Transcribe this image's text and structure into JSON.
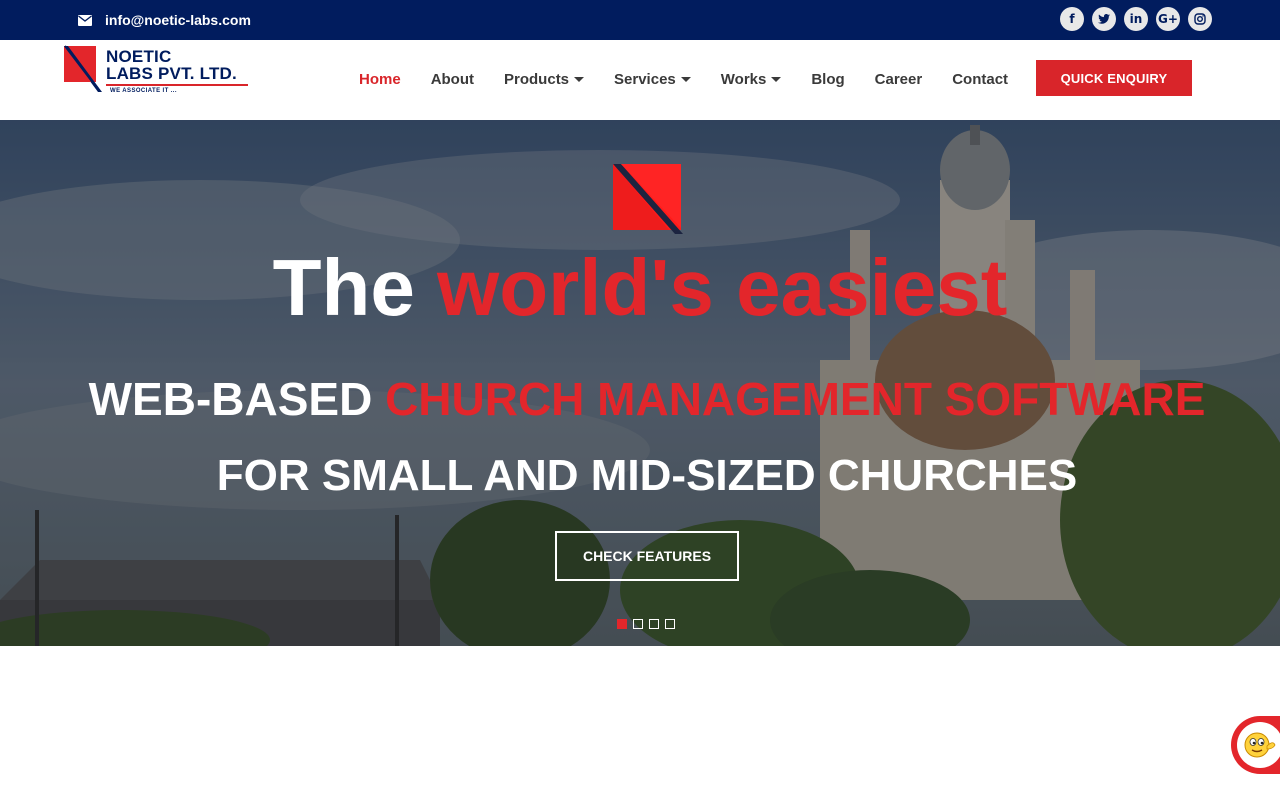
{
  "topbar": {
    "email": "info@noetic-labs.com",
    "mail_icon": "envelope-icon",
    "socials": [
      {
        "name": "facebook-icon",
        "glyph": "f"
      },
      {
        "name": "twitter-icon",
        "glyph": "t"
      },
      {
        "name": "linkedin-icon",
        "glyph": "in"
      },
      {
        "name": "google-plus-icon",
        "glyph": "G+"
      },
      {
        "name": "instagram-icon",
        "glyph": "◎"
      }
    ]
  },
  "logo": {
    "line1": "NOETIC",
    "line2": "LABS PVT. LTD.",
    "tagline": "WE ASSOCIATE IT ..."
  },
  "nav": {
    "home": "Home",
    "about": "About",
    "products": "Products",
    "services": "Services",
    "works": "Works",
    "blog": "Blog",
    "career": "Career",
    "contact": "Contact",
    "active": "Home"
  },
  "enquiry_button": "QUICK ENQUIRY",
  "hero": {
    "line1_white": "The ",
    "line1_red": "world's easiest",
    "line2_white": "WEB-BASED ",
    "line2_red": "CHURCH MANAGEMENT SOFTWARE",
    "line3": "FOR SMALL AND MID-SIZED CHURCHES",
    "cta": "CHECK FEATURES",
    "slides": 4,
    "active_slide": 1
  },
  "colors": {
    "navy": "#011c5e",
    "brand_red": "#d9252a"
  },
  "chat_widget": {
    "icon": "chat-face-icon"
  }
}
